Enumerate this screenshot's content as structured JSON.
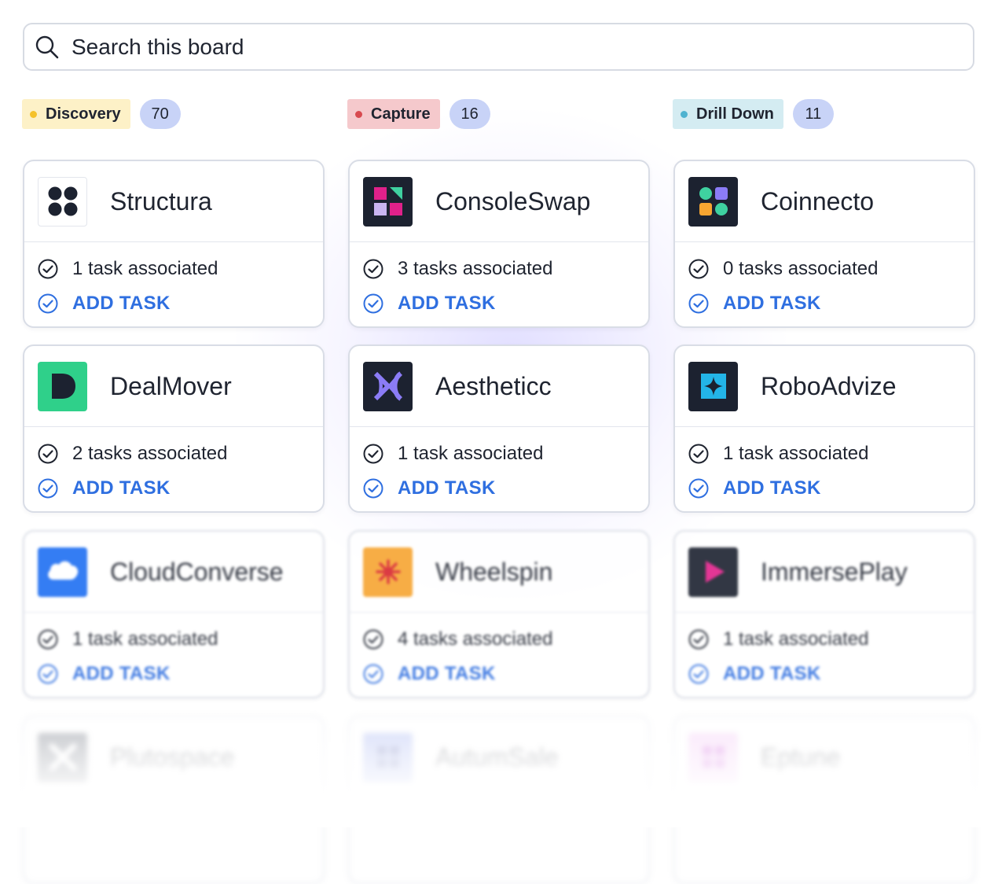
{
  "search": {
    "placeholder": "Search this board",
    "icon": "search-icon"
  },
  "columns": [
    {
      "label": "Discovery",
      "count": "70",
      "tag_bg": "#fdf1c7",
      "dot": "#f5c22b"
    },
    {
      "label": "Capture",
      "count": "16",
      "tag_bg": "#f5c9cc",
      "dot": "#d84a4f"
    },
    {
      "label": "Drill Down",
      "count": "11",
      "tag_bg": "#d4ecf2",
      "dot": "#4fb3d0"
    }
  ],
  "cards": [
    {
      "name": "Structura",
      "tasks": "1 task associated",
      "add": "ADD TASK"
    },
    {
      "name": "ConsoleSwap",
      "tasks": "3 tasks associated",
      "add": "ADD TASK"
    },
    {
      "name": "Coinnecto",
      "tasks": "0 tasks associated",
      "add": "ADD TASK"
    },
    {
      "name": "DealMover",
      "tasks": "2 tasks associated",
      "add": "ADD TASK"
    },
    {
      "name": "Aestheticc",
      "tasks": "1 task associated",
      "add": "ADD TASK"
    },
    {
      "name": "RoboAdvize",
      "tasks": "1 task associated",
      "add": "ADD TASK"
    },
    {
      "name": "CloudConverse",
      "tasks": "1 task associated",
      "add": "ADD TASK"
    },
    {
      "name": "Wheelspin",
      "tasks": "4 tasks associated",
      "add": "ADD TASK"
    },
    {
      "name": "ImmersePlay",
      "tasks": "1 task associated",
      "add": "ADD TASK"
    },
    {
      "name": "Plutospace"
    },
    {
      "name": "AutumSale"
    },
    {
      "name": "Eptune"
    }
  ],
  "colors": {
    "accent": "#2f6fe0",
    "count_pill": "#c8d3f7",
    "text": "#1f2430"
  }
}
